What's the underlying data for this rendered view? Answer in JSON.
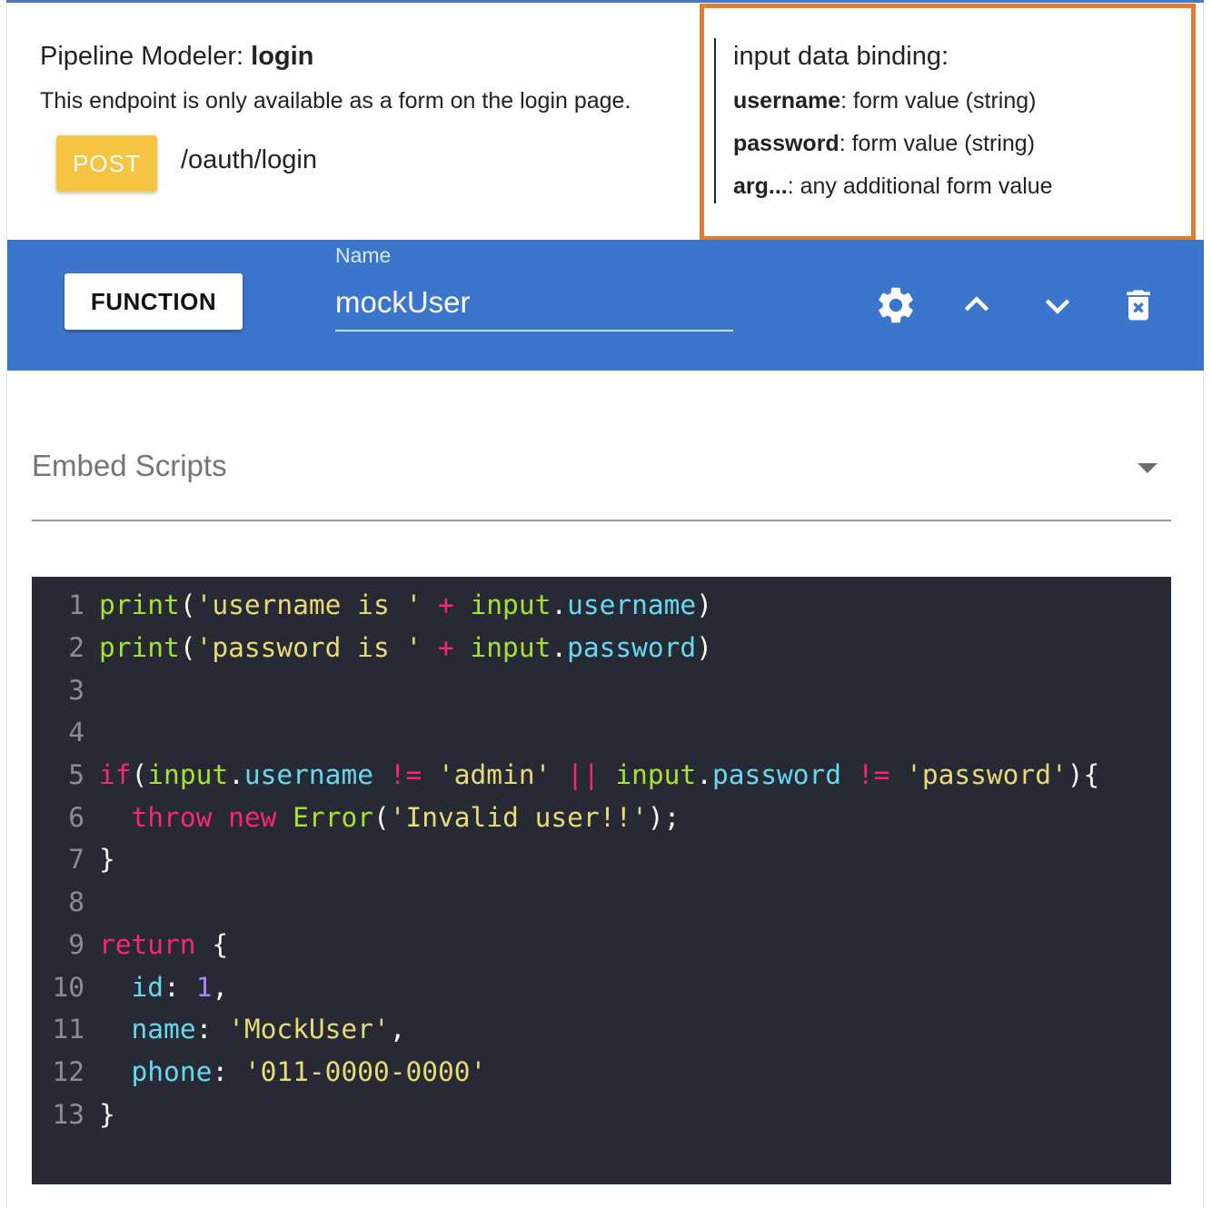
{
  "header": {
    "title_prefix": "Pipeline Modeler: ",
    "title_name": "login",
    "description": "This endpoint is only available as a form on the login page.",
    "method": "POST",
    "path": "/oauth/login"
  },
  "binding": {
    "title": "input data binding:",
    "items": [
      {
        "key": "username",
        "desc": ": form value (string)"
      },
      {
        "key": "password",
        "desc": ": form value (string)"
      },
      {
        "key": "arg...",
        "desc": ": any additional form value"
      }
    ]
  },
  "function_bar": {
    "type_label": "FUNCTION",
    "name_label": "Name",
    "name_value": "mockUser",
    "icons": [
      "settings-icon",
      "chevron-up-icon",
      "chevron-down-icon",
      "delete-icon"
    ]
  },
  "embed": {
    "label": "Embed Scripts"
  },
  "code": {
    "line_numbers": [
      "1",
      "2",
      "3",
      "4",
      "5",
      "6",
      "7",
      "8",
      "9",
      "10",
      "11",
      "12",
      "13"
    ],
    "tokens": {
      "l1": [
        "print",
        "(",
        "'username is '",
        " + ",
        "input",
        ".",
        "username",
        ")"
      ],
      "l2": [
        "print",
        "(",
        "'password is '",
        " + ",
        "input",
        ".",
        "password",
        ")"
      ],
      "l5": [
        "if",
        "(",
        "input",
        ".",
        "username",
        " != ",
        "'admin'",
        " || ",
        "input",
        ".",
        "password",
        " != ",
        "'password'",
        "){"
      ],
      "l6": [
        "  ",
        "throw",
        " ",
        "new",
        " ",
        "Error",
        "(",
        "'Invalid user!!'",
        ");"
      ],
      "l7": [
        "}"
      ],
      "l9": [
        "return",
        " {"
      ],
      "l10": [
        "  ",
        "id",
        ": ",
        "1",
        ","
      ],
      "l11": [
        "  ",
        "name",
        ": ",
        "'MockUser'",
        ","
      ],
      "l12": [
        "  ",
        "phone",
        ": ",
        "'011-0000-0000'"
      ],
      "l13": [
        "}"
      ]
    }
  },
  "colors": {
    "accent_bar": "#3c76cc",
    "post_button": "#f6c443",
    "highlight_box": "#e07d34",
    "editor_bg": "#272a35"
  }
}
